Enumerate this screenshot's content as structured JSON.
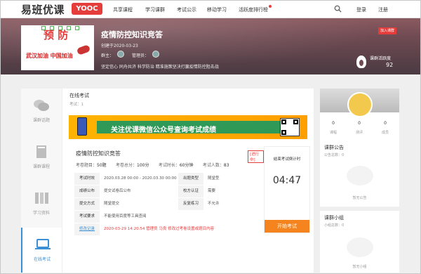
{
  "nav": {
    "logo": "易班优课",
    "badge": "YOOC",
    "items": [
      "共享课程",
      "学习课群",
      "考试公示",
      "移动学习",
      "活跃度排行榜"
    ],
    "login": "登录",
    "register": "注册"
  },
  "banner": {
    "cover_title": "预 防",
    "cover_sub": "武汉加油 中国加油",
    "title": "疫情防控知识竞答",
    "created": "创建于2020-03-23",
    "owner_label": "群主：",
    "manager_label": "管理员：",
    "tags": "坚定信心  同舟共济  科学防治  精准施策坚决打赢疫情防控阻击战",
    "join": "加入课群",
    "activity_label": "课群活跃度",
    "activity_value": "92"
  },
  "sidebar": [
    {
      "label": "课群话题",
      "icon": "chat-icon"
    },
    {
      "label": "课群课程",
      "icon": "book-icon"
    },
    {
      "label": "学习资料",
      "icon": "files-icon"
    },
    {
      "label": "在线考试",
      "icon": "laptop-icon"
    }
  ],
  "main": {
    "title": "在线考试",
    "count": "考试：1",
    "promo": "关注优课微信公众号查询考试成绩"
  },
  "exam": {
    "name": "疫情防控知识竞答",
    "status": "[进行中]",
    "meta": [
      {
        "k": "考卷题目：",
        "v": "50题"
      },
      {
        "k": "考卷总分：",
        "v": "100分"
      },
      {
        "k": "考试时长：",
        "v": "60分钟"
      },
      {
        "k": "考试人数：",
        "v": "83"
      }
    ],
    "rows": [
      {
        "k": "考试时效",
        "v": "2020.03.28 00:00 - 2020.03.30 00:00",
        "k2": "出题类型",
        "v2": "随堂型"
      },
      {
        "k": "成绩公布",
        "v": "提交试卷后公布",
        "k2": "校方认证",
        "v2": "需要"
      },
      {
        "k": "提交方式",
        "v": "随堂提交",
        "k2": "反复练习",
        "v2": "不允许"
      },
      {
        "k": "考试要求",
        "v": "不能使用百度等工具查阅",
        "k2": "",
        "v2": ""
      },
      {
        "k": "修改记录",
        "v": "2020-03-29 14:20:54 管理员 马良 修改过考卷设置或题目内容",
        "k2": "",
        "v2": ""
      }
    ],
    "timer_label": "结束考试倒计时",
    "timer_value": "04:47",
    "start": "开始考试"
  },
  "right": {
    "stats": [
      {
        "n": "0",
        "l": "课程"
      },
      {
        "n": "0",
        "l": "测评"
      },
      {
        "n": "0",
        "l": "成员"
      }
    ],
    "notice_title": "课群公告",
    "notice_sub": "公告总数：0",
    "notice_empty": "暂无公告",
    "group_title": "课群小组",
    "group_sub": "小组总数：0",
    "group_empty": "暂无小组"
  }
}
